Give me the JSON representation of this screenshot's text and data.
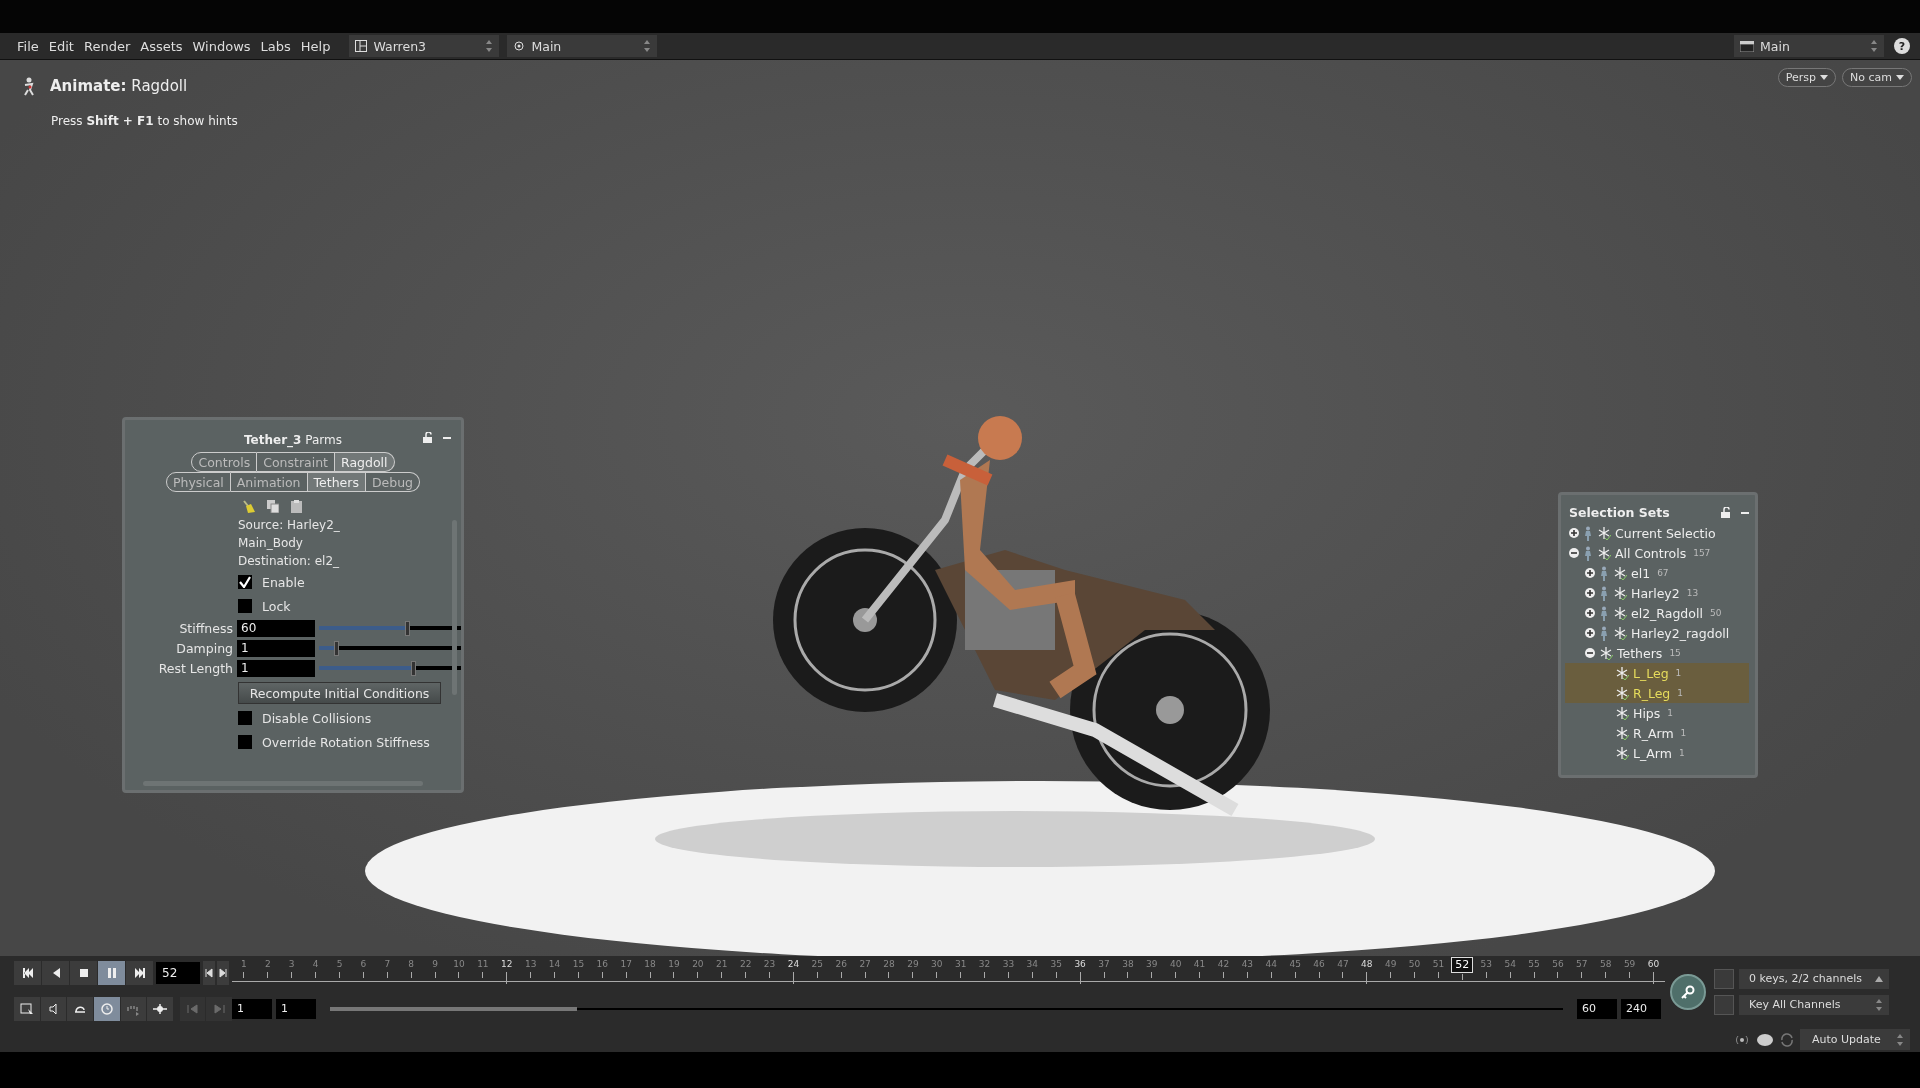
{
  "menu_bar": {
    "items": [
      "File",
      "Edit",
      "Render",
      "Assets",
      "Windows",
      "Labs",
      "Help"
    ],
    "desktop": "Warren3",
    "viewport_layout": "Main",
    "context": "Main",
    "help": "?"
  },
  "viewport": {
    "tool_title": "**Animate:** Ragdoll",
    "hint": "Press **Shift + F1** to show hints",
    "camera_buttons": [
      "Persp",
      "No cam"
    ]
  },
  "parms_panel": {
    "title": "**Tether_3** Parms",
    "tabs_row_1": [
      {
        "label": "Controls",
        "selected": false
      },
      {
        "label": "Constraint",
        "selected": false
      },
      {
        "label": "Ragdoll",
        "selected": true
      }
    ],
    "tabs_row_2": [
      {
        "label": "Physical",
        "selected": false
      },
      {
        "label": "Animation",
        "selected": false
      },
      {
        "label": "Tethers",
        "selected": true
      },
      {
        "label": "Debug",
        "selected": false
      }
    ],
    "info_lines": [
      "Source: Harley2_",
      "Main_Body",
      "Destination: el2_"
    ],
    "top_checkboxes": [
      {
        "label": "Enable",
        "checked": true
      },
      {
        "label": "Lock",
        "checked": false
      }
    ],
    "sliders": [
      {
        "label": "Stiffness",
        "value": "60",
        "level": 0.62
      },
      {
        "label": "Damping",
        "value": "1",
        "level": 0.12
      },
      {
        "label": "Rest Length",
        "value": "1",
        "level": 0.66
      }
    ],
    "button": "Recompute Initial Conditions",
    "bottom_checkboxes": [
      {
        "label": "Disable Collisions",
        "checked": false
      },
      {
        "label": "Override Rotation Stiffness",
        "checked": false
      }
    ]
  },
  "selection_sets": {
    "title": "Selection Sets",
    "items": [
      {
        "label": "Current Selectio",
        "kind": "character",
        "expanded": false,
        "selected": false
      },
      {
        "label": "All Controls",
        "count": "157",
        "kind": "character",
        "expanded": true,
        "selected": false,
        "children": [
          {
            "label": "el1",
            "count": "67",
            "kind": "character",
            "expanded": false,
            "selected": false
          },
          {
            "label": "Harley2",
            "count": "13",
            "kind": "character",
            "expanded": false,
            "selected": false
          },
          {
            "label": "el2_Ragdoll",
            "count": "50",
            "kind": "character",
            "expanded": false,
            "selected": false
          },
          {
            "label": "Harley2_ragdoll",
            "kind": "character",
            "expanded": false,
            "selected": false
          },
          {
            "label": "Tethers",
            "count": "15",
            "kind": "set",
            "expanded": true,
            "selected": false,
            "children": [
              {
                "label": "L_Leg",
                "count": "1",
                "kind": "set",
                "selected": true
              },
              {
                "label": "R_Leg",
                "count": "1",
                "kind": "set",
                "selected": true
              },
              {
                "label": "Hips",
                "count": "1",
                "kind": "set",
                "selected": false
              },
              {
                "label": "R_Arm",
                "count": "1",
                "kind": "set",
                "selected": false
              },
              {
                "label": "L_Arm",
                "count": "1",
                "kind": "set",
                "selected": false
              }
            ]
          }
        ]
      }
    ]
  },
  "timeline": {
    "playback_buttons": [
      {
        "kind": "jump-start",
        "selected": false
      },
      {
        "kind": "play-back",
        "selected": false
      },
      {
        "kind": "stop",
        "selected": false
      },
      {
        "kind": "pause",
        "selected": true
      },
      {
        "kind": "jump-end",
        "selected": false
      }
    ],
    "frame_field": "52",
    "tool_buttons": [
      {
        "kind": "select",
        "selected": false
      },
      {
        "kind": "audio",
        "selected": false
      },
      {
        "kind": "loop",
        "selected": false
      },
      {
        "kind": "realtime",
        "selected": true
      },
      {
        "kind": "ticks",
        "selected": false
      },
      {
        "kind": "keys",
        "selected": false
      }
    ],
    "range_start": [
      "1",
      "1"
    ],
    "range_end": [
      "60",
      "240"
    ],
    "frames": [
      {
        "label": "1",
        "major": false,
        "current": false
      },
      {
        "label": "2",
        "major": false,
        "current": false
      },
      {
        "label": "3",
        "major": false,
        "current": false
      },
      {
        "label": "4",
        "major": false,
        "current": false
      },
      {
        "label": "5",
        "major": false,
        "current": false
      },
      {
        "label": "6",
        "major": false,
        "current": false
      },
      {
        "label": "7",
        "major": false,
        "current": false
      },
      {
        "label": "8",
        "major": false,
        "current": false
      },
      {
        "label": "9",
        "major": false,
        "current": false
      },
      {
        "label": "10",
        "major": false,
        "current": false
      },
      {
        "label": "11",
        "major": false,
        "current": false
      },
      {
        "label": "12",
        "major": true,
        "current": false
      },
      {
        "label": "13",
        "major": false,
        "current": false
      },
      {
        "label": "14",
        "major": false,
        "current": false
      },
      {
        "label": "15",
        "major": false,
        "current": false
      },
      {
        "label": "16",
        "major": false,
        "current": false
      },
      {
        "label": "17",
        "major": false,
        "current": false
      },
      {
        "label": "18",
        "major": false,
        "current": false
      },
      {
        "label": "19",
        "major": false,
        "current": false
      },
      {
        "label": "20",
        "major": false,
        "current": false
      },
      {
        "label": "21",
        "major": false,
        "current": false
      },
      {
        "label": "22",
        "major": false,
        "current": false
      },
      {
        "label": "23",
        "major": false,
        "current": false
      },
      {
        "label": "24",
        "major": true,
        "current": false
      },
      {
        "label": "25",
        "major": false,
        "current": false
      },
      {
        "label": "26",
        "major": false,
        "current": false
      },
      {
        "label": "27",
        "major": false,
        "current": false
      },
      {
        "label": "28",
        "major": false,
        "current": false
      },
      {
        "label": "29",
        "major": false,
        "current": false
      },
      {
        "label": "30",
        "major": false,
        "current": false
      },
      {
        "label": "31",
        "major": false,
        "current": false
      },
      {
        "label": "32",
        "major": false,
        "current": false
      },
      {
        "label": "33",
        "major": false,
        "current": false
      },
      {
        "label": "34",
        "major": false,
        "current": false
      },
      {
        "label": "35",
        "major": false,
        "current": false
      },
      {
        "label": "36",
        "major": true,
        "current": false
      },
      {
        "label": "37",
        "major": false,
        "current": false
      },
      {
        "label": "38",
        "major": false,
        "current": false
      },
      {
        "label": "39",
        "major": false,
        "current": false
      },
      {
        "label": "40",
        "major": false,
        "current": false
      },
      {
        "label": "41",
        "major": false,
        "current": false
      },
      {
        "label": "42",
        "major": false,
        "current": false
      },
      {
        "label": "43",
        "major": false,
        "current": false
      },
      {
        "label": "44",
        "major": false,
        "current": false
      },
      {
        "label": "45",
        "major": false,
        "current": false
      },
      {
        "label": "46",
        "major": false,
        "current": false
      },
      {
        "label": "47",
        "major": false,
        "current": false
      },
      {
        "label": "48",
        "major": true,
        "current": false
      },
      {
        "label": "49",
        "major": false,
        "current": false
      },
      {
        "label": "50",
        "major": false,
        "current": false
      },
      {
        "label": "51",
        "major": false,
        "current": false
      },
      {
        "label": "52",
        "major": false,
        "current": true
      },
      {
        "label": "53",
        "major": false,
        "current": false
      },
      {
        "label": "54",
        "major": false,
        "current": false
      },
      {
        "label": "55",
        "major": false,
        "current": false
      },
      {
        "label": "56",
        "major": false,
        "current": false
      },
      {
        "label": "57",
        "major": false,
        "current": false
      },
      {
        "label": "58",
        "major": false,
        "current": false
      },
      {
        "label": "59",
        "major": false,
        "current": false
      },
      {
        "label": "60",
        "major": true,
        "current": false
      }
    ],
    "range_selection": {
      "level": 0.2
    },
    "keys_menu": "0 keys, 2/2 channels",
    "key_mode": "Key All Channels"
  },
  "status_bar": {
    "update_mode": "Auto Update"
  }
}
